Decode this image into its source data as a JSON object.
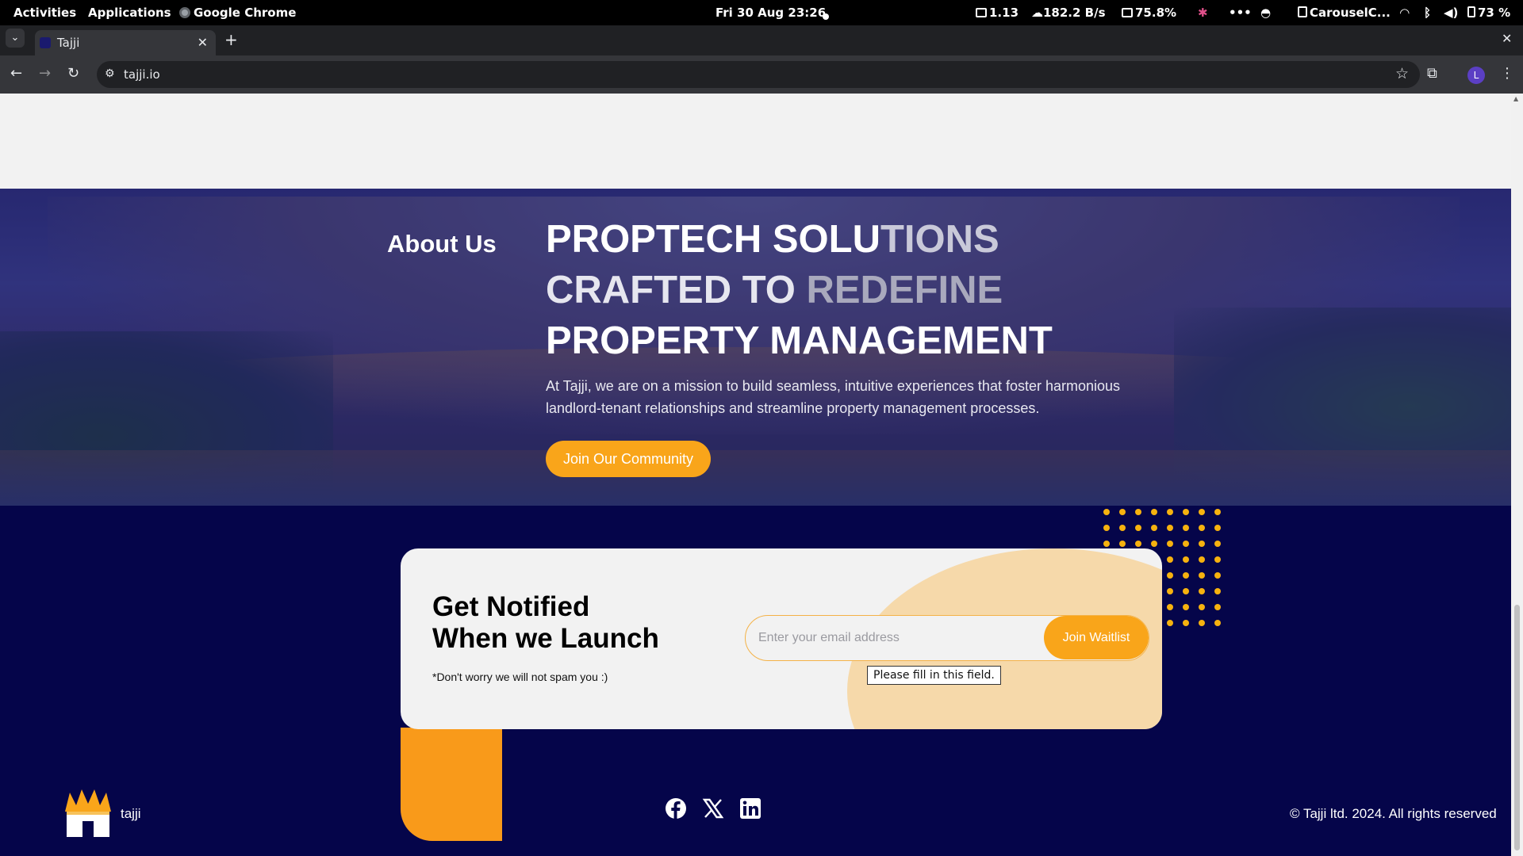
{
  "system_bar": {
    "activities": "Activities",
    "applications": "Applications",
    "app_name": "Google Chrome",
    "datetime": "Fri 30 Aug  23:26",
    "load": "1.13",
    "network": "182.2 B/s",
    "memory": "75.8%",
    "more": "•••",
    "window_title": "CarouselC...",
    "battery": "73 %"
  },
  "browser": {
    "tab_title": "Tajji",
    "url": "tajji.io",
    "profile_initial": "L"
  },
  "about": {
    "label": "About Us",
    "headline_line1_a": "PROPTECH SOLU",
    "headline_line1_b": "TIONS",
    "headline_line2_a": "CRAFTED TO",
    "headline_line2_b": " REDEFINE",
    "headline_line3": "PROPERTY MANAGEMENT",
    "mission": "At Tajji, we are on a mission to build seamless, intuitive experiences that foster harmonious landlord-tenant relationships and streamline property management processes.",
    "cta": "Join Our Community"
  },
  "notify": {
    "title_line1": "Get Notified",
    "title_line2": "When we Launch",
    "subtext": "*Don't worry we will not spam you :)",
    "email_placeholder": "Enter your email address",
    "email_value": "",
    "button": "Join Waitlist",
    "validation_tooltip": "Please fill in this field."
  },
  "footer": {
    "brand": "tajji",
    "social": [
      "facebook-icon",
      "x-icon",
      "linkedin-icon"
    ],
    "copyright": "© Tajji ltd. 2024. All rights reserved"
  },
  "colors": {
    "navy": "#05054a",
    "accent_orange": "#f9a51a",
    "peach": "#f6d9aa",
    "dot_yellow": "#f6b20f"
  }
}
